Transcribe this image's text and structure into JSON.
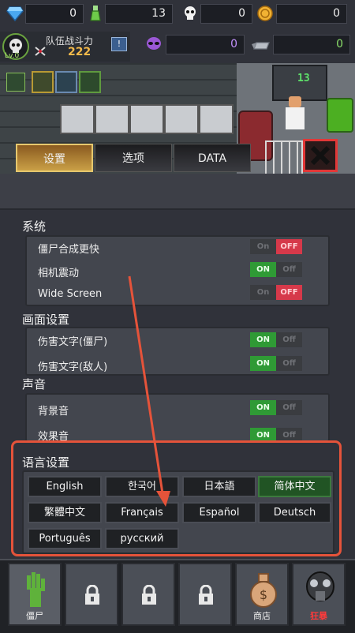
{
  "resources": {
    "gems": "0",
    "potion": "13",
    "skulls": "0",
    "coins": "0",
    "alien": "0",
    "metal": "0"
  },
  "team": {
    "label": "队伍战斗力",
    "power": "222",
    "level": "Lv.0"
  },
  "scene": {
    "monitor_value": "13"
  },
  "tabs": [
    {
      "label": "设置"
    },
    {
      "label": "选项"
    },
    {
      "label": "DATA"
    }
  ],
  "sections": {
    "system": {
      "title": "系统",
      "rows": [
        {
          "label": "僵尸合成更快",
          "state": "OFF"
        },
        {
          "label": "相机震动",
          "state": "ON"
        },
        {
          "label": "Wide Screen",
          "state": "OFF"
        }
      ]
    },
    "display": {
      "title": "画面设置",
      "rows": [
        {
          "label": "伤害文字(僵尸)",
          "state": "ON"
        },
        {
          "label": "伤害文字(敌人)",
          "state": "ON"
        }
      ]
    },
    "sound": {
      "title": "声音",
      "rows": [
        {
          "label": "背景音",
          "state": "ON"
        },
        {
          "label": "效果音",
          "state": "ON"
        }
      ]
    },
    "language": {
      "title": "语言设置",
      "options": [
        "English",
        "한국어",
        "日本語",
        "简体中文",
        "繁體中文",
        "Français",
        "Español",
        "Deutsch",
        "Português",
        "русский"
      ],
      "selected": "简体中文"
    }
  },
  "toggle_text": {
    "on": "ON",
    "off": "OFF",
    "on_dim": "On",
    "off_dim": "Off"
  },
  "bottom_bar": {
    "zombie_label": "僵尸",
    "shop_label": "商店",
    "event_label": "狂暴"
  },
  "colors": {
    "on_green": "#2f9a35",
    "off_red": "#d6394a",
    "highlight_red": "#e5533a"
  }
}
